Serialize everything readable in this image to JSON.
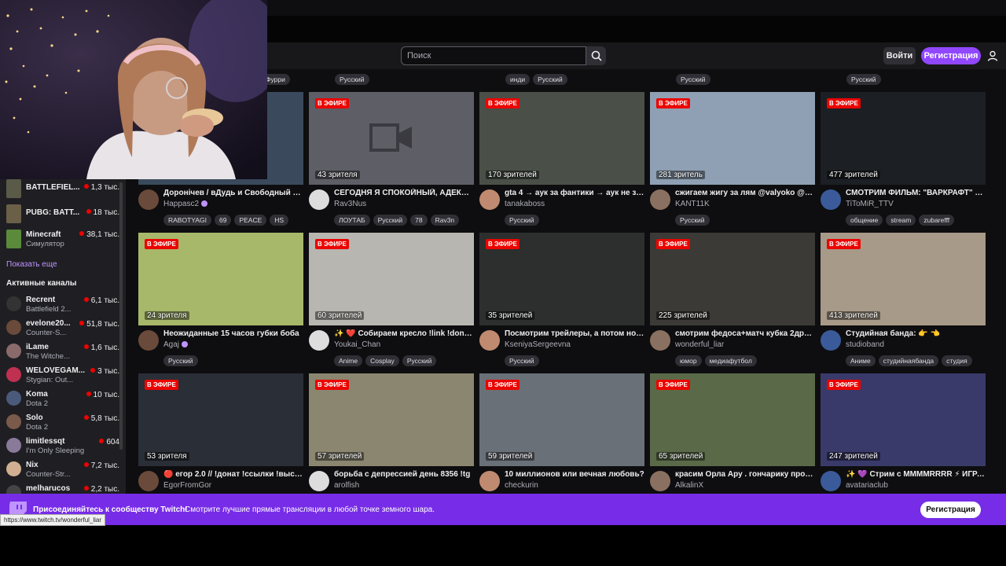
{
  "header": {
    "search_placeholder": "Поиск",
    "login_label": "Войти",
    "signup_label": "Регистрация"
  },
  "top_tags": [
    {
      "items": [
        "Фурри"
      ]
    },
    {
      "items": [
        "Русский"
      ]
    },
    {
      "items": [
        "инди",
        "Русский"
      ]
    },
    {
      "items": [
        "Русский"
      ]
    },
    {
      "items": [
        "Русский"
      ]
    }
  ],
  "live_badge": "В ЭФИРЕ",
  "streams": [
    {
      "viewers": "",
      "title": "Доронічев / вДудь и Свободный Ве...",
      "channel": "Happasc2",
      "verified": true,
      "tags": [
        "RABOTYAGI",
        "69",
        "PEACE",
        "HS"
      ],
      "color": "#3a4a5c"
    },
    {
      "viewers": "43 зрителя",
      "title": "СЕГОДНЯ Я СПОКОЙНЫЙ, АДЕКВАТ...",
      "channel": "Rav3Nus",
      "verified": false,
      "tags": [
        "ЛОУТАБ",
        "Русский",
        "78",
        "Rav3n"
      ],
      "color": "#5e5e66",
      "placeholder": true
    },
    {
      "viewers": "170 зрителей",
      "title": "gta 4 → аук за фантики → аук не за ...",
      "channel": "tanakaboss",
      "verified": false,
      "tags": [
        "Русский"
      ],
      "color": "#4a5048"
    },
    {
      "viewers": "281 зритель",
      "title": "сжигаем жигу за лям @valyoko @ke...",
      "channel": "KANT11K",
      "verified": false,
      "tags": [
        "Русский"
      ],
      "color": "#8fa0b4"
    },
    {
      "viewers": "477 зрителей",
      "title": "СМОТРИМ ФИЛЬМ: \"ВАРКРАФТ\" 💵...",
      "channel": "TiToMiR_TTV",
      "verified": false,
      "tags": [
        "общение",
        "stream",
        "zubarefff"
      ],
      "color": "#1c1f24"
    },
    {
      "viewers": "24 зрителя",
      "title": "Неожиданные 15 часов губки боба",
      "channel": "Agaj",
      "verified": true,
      "tags": [
        "Русский"
      ],
      "color": "#a8b86a"
    },
    {
      "viewers": "60 зрителей",
      "title": "✨ ❤️ Собираем кресло !link !donate ...",
      "channel": "Youkai_Chan",
      "verified": false,
      "tags": [
        "Anime",
        "Cosplay",
        "Русский"
      ],
      "color": "#b8b6b0"
    },
    {
      "viewers": "35 зрителей",
      "title": "Посмотрим трейлеры, а потом ново...",
      "channel": "KseniyaSergeevna",
      "verified": false,
      "tags": [
        "Русский"
      ],
      "color": "#2c2f2e"
    },
    {
      "viewers": "225 зрителей",
      "title": "смотрим федоса+матч кубка 2дрот...",
      "channel": "wonderful_liar",
      "verified": false,
      "tags": [
        "юмор",
        "медиафутбол"
      ],
      "color": "#3c3a36"
    },
    {
      "viewers": "413 зрителей",
      "title": "Студийная банда: 👉 👈",
      "channel": "studioband",
      "verified": false,
      "tags": [
        "Аниме",
        "студийнаябанда",
        "студия"
      ],
      "color": "#a89a88"
    },
    {
      "viewers": "53 зрителя",
      "title": "🔴 егор 2.0 // !донат !ссылки !выстр...",
      "channel": "EgorFromGor",
      "verified": false,
      "tags": [],
      "color": "#2a2e36"
    },
    {
      "viewers": "57 зрителей",
      "title": "борьба с депрессией день 8356 !tg",
      "channel": "arolfish",
      "verified": false,
      "tags": [],
      "color": "#8a8670"
    },
    {
      "viewers": "59 зрителей",
      "title": "10 миллионов или вечная любовь?",
      "channel": "checkurin",
      "verified": false,
      "tags": [],
      "color": "#6a7078"
    },
    {
      "viewers": "65 зрителей",
      "title": "красим Орла Ару . гончарику прове...",
      "channel": "AlkalinX",
      "verified": false,
      "tags": [],
      "color": "#5a6a48"
    },
    {
      "viewers": "247 зрителей",
      "title": "✨ 💜 Стрим с MMMMRRRR ⚡ ИГРА \"...",
      "channel": "avatariaclub",
      "verified": false,
      "tags": [],
      "color": "#3a3a6a"
    }
  ],
  "sidebar": {
    "categories": [
      {
        "name": "BATTLEFIEL...",
        "count": "1,3 тыс.",
        "color": "#5a5a48"
      },
      {
        "name": "PUBG: BATT...",
        "count": "18 тыс.",
        "color": "#6a6048"
      },
      {
        "name": "Minecraft",
        "sub": "Симулятор",
        "count": "38,1 тыс.",
        "color": "#5a8a3a"
      }
    ],
    "show_more": "Показать еще",
    "active_title": "Активные каналы",
    "channels": [
      {
        "name": "Recrent",
        "sub": "Battlefield 2...",
        "count": "6,1 тыс.",
        "color": "#333"
      },
      {
        "name": "evelone20...",
        "sub": "Counter-S...",
        "count": "51,8 тыс.",
        "color": "#6a4a3a"
      },
      {
        "name": "iLame",
        "sub": "The Witche...",
        "count": "1,6 тыс.",
        "color": "#8a6a6a"
      },
      {
        "name": "WELOVEGAM...",
        "sub": "Stygian: Out...",
        "count": "3 тыс.",
        "color": "#c03050"
      },
      {
        "name": "Koma",
        "sub": "Dota 2",
        "count": "10 тыс.",
        "color": "#4a5a7a"
      },
      {
        "name": "Solo",
        "sub": "Dota 2",
        "count": "5,8 тыс.",
        "color": "#7a5a4a"
      },
      {
        "name": "limitlessqt",
        "sub": "I'm Only Sleeping",
        "count": "604",
        "color": "#8a7a9a"
      },
      {
        "name": "Nix",
        "sub": "Counter-Str...",
        "count": "7,2 тыс.",
        "color": "#d0b090"
      },
      {
        "name": "melharucos",
        "sub": "",
        "count": "2,2 тыс.",
        "color": "#444"
      }
    ]
  },
  "banner": {
    "headline": "Присоединяйтесь к сообществу Twitch!",
    "text": "Смотрите лучшие прямые трансляции в любой точке земного шара.",
    "button": "Регистрация"
  },
  "status_url": "https://www.twitch.tv/wonderful_liar"
}
